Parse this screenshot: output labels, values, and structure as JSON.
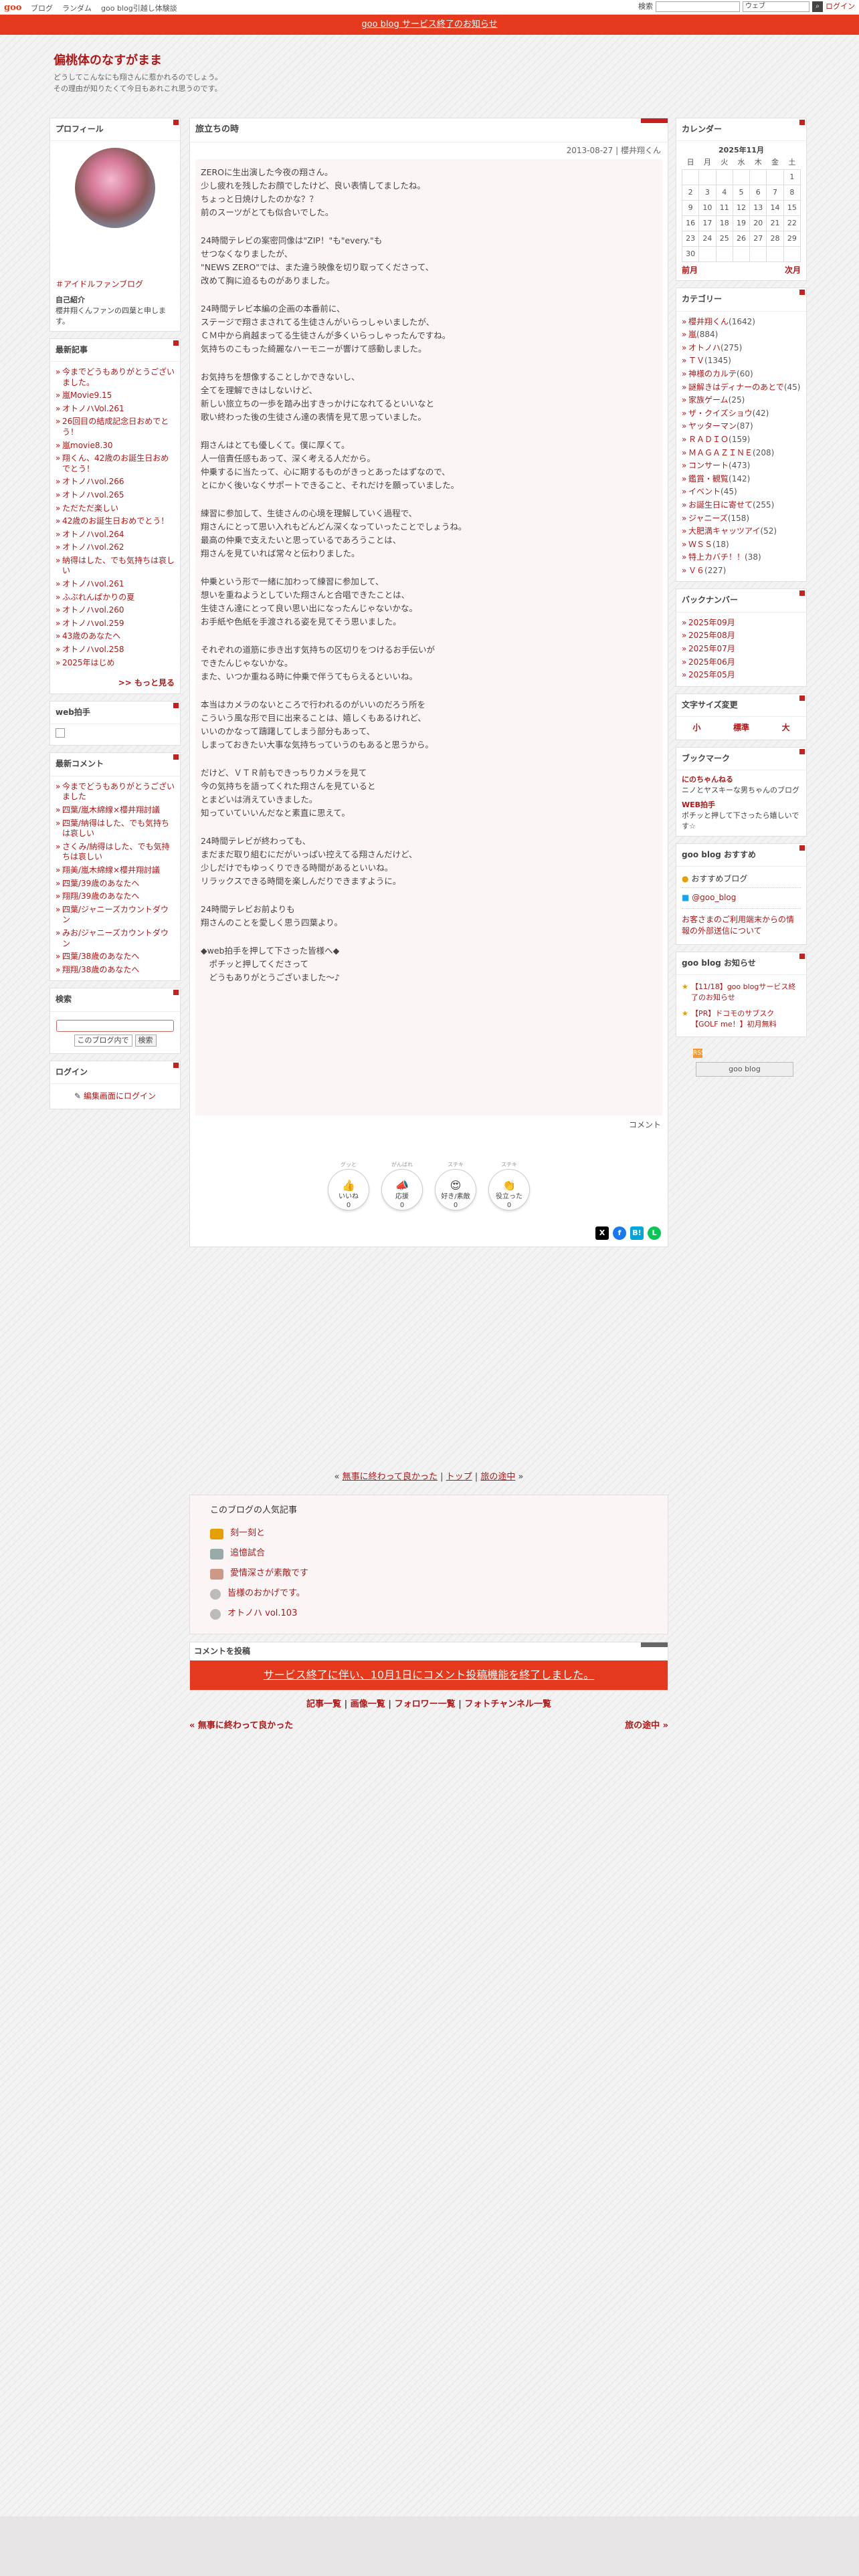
{
  "topbar": {
    "logo": "goo",
    "links": [
      "ブログ",
      "ランダム",
      "goo blog引越し体験談"
    ],
    "search_label": "検索",
    "search_select": "ウェブ",
    "login": "ログイン"
  },
  "notice": "goo blog サービス終了のお知らせ",
  "blog": {
    "title": "偏桃体のなすがまま",
    "desc1": "どうしてこんなにも翔さんに惹かれるのでしょう。",
    "desc2": "その理由が知りたくて今日もあれこれ思うのです。"
  },
  "profile": {
    "title": "プロフィール",
    "tag": "＃アイドルファンブログ",
    "intro_label": "自己紹介",
    "intro": "櫻井翔くんファンの四葉と申します。"
  },
  "recent": {
    "title": "最新記事",
    "items": [
      "今までどうもありがとうございました。",
      "嵐Movie9.15",
      "オトノハVol.261",
      "26回目の結成記念日おめでとう！",
      "嵐movie8.30",
      "翔くん、42歳のお誕生日おめでとう！",
      "オトノハvol.266",
      "オトノハvol.265",
      "ただただ楽しい",
      "42歳のお誕生日おめでとう！",
      "オトノハvol.264",
      "オトノハvol.262",
      "納得はした、でも気持ちは哀しい",
      "オトノハvol.261",
      "ふぶれんぱかりの夏",
      "オトノハvol.260",
      "オトノハvol.259",
      "43歳のあなたへ",
      "オトノハvol.258",
      "2025年はじめ"
    ],
    "more": ">> もっと見る"
  },
  "webclap": {
    "title": "web拍手"
  },
  "comments": {
    "title": "最新コメント",
    "items": [
      "今までどうもありがとうございました",
      "四葉/嵐木綿線×櫻井翔討議",
      "四葉/納得はした、でも気持ちは哀しい",
      "さくみ/納得はした、でも気持ちは哀しい",
      "翔美/嵐木綿線×櫻井翔討議",
      "四葉/39歳のあなたへ",
      "翔翔/39歳のあなたへ",
      "四葉/ジャニーズカウントダウン",
      "みお/ジャニーズカウントダウン",
      "四葉/38歳のあなたへ",
      "翔翔/38歳のあなたへ"
    ]
  },
  "search": {
    "title": "検索",
    "select": "このブログ内で",
    "btn": "検索"
  },
  "login": {
    "title": "ログイン",
    "link": "編集画面にログイン"
  },
  "article": {
    "title": "旅立ちの時",
    "meta": "2013-08-27 | 櫻井翔くん",
    "paras": [
      [
        "ZEROに生出演した今夜の翔さん。",
        "少し疲れを残したお顔でしたけど、良い表情してましたね。",
        "ちょっと日焼けしたのかな？？",
        "前のスーツがとても似合いでした。"
      ],
      [
        "24時間テレビの案密同像は\"ZIP！\"も\"every.\"も",
        "せつなくなりましたが、",
        "\"NEWS ZERO\"では、また違う映像を切り取ってくださって、",
        "改めて胸に迫るものがありました。"
      ],
      [
        "24時間テレビ本編の企画の本番前に、",
        "ステージで翔さまされてる生徒さんがいらっしゃいましたが、",
        "ＣＭ中から肩越まってる生徒さんが多くいらっしゃったんですね。",
        "気持ちのこもった綺麗なハーモニーが響けて感動しました。"
      ],
      [
        "お気持ちを想像することしかできないし、",
        "全てを理解できはしないけど、",
        "新しい旅立ちの一歩を踏み出すきっかけになれてるといいなと",
        "歌い終わった後の生徒さん達の表情を見て思っていました。"
      ],
      [
        "翔さんはとても優しくて。僕に厚くて。",
        "人一倍責任感もあって、深く考える人だから。",
        "仲乗するに当たって、心に期するものがきっとあったはずなので、",
        "とにかく後いなくサポートできること、それだけを願っていました。"
      ],
      [
        "練習に参加して、生徒さんの心境を理解していく過程で、",
        "翔さんにとって思い入れもどんどん深くなっていったことでしょうね。",
        "最高の仲乗で支えたいと思っているであろうことは、",
        "翔さんを見ていれば常々と伝わりました。"
      ],
      [
        "仲乗という形で一緒に加わって練習に参加して、",
        "想いを重ねようとしていた翔さんと合唱できたことは、",
        "生徒さん達にとって良い思い出になったんじゃないかな。",
        "お手紙や色紙を手渡される姿を見てそう思いました。"
      ],
      [
        "それぞれの道筋に歩き出す気持ちの区切りをつけるお手伝いが",
        "できたんじゃないかな。",
        "また、いつか重ねる時に仲乗で伴うてもらえるといいね。"
      ],
      [
        "本当はカメラのないところで行われるのがいいのだろう所を",
        "こういう風な形で目に出来ることは、嬉しくもあるけれど、",
        "いいのかなって躊躇してしまう部分もあって、",
        "しまっておきたい大事な気持ちっていうのもあると思うから。"
      ],
      [
        "だけど、ＶＴＲ前もできっちりカメラを見て",
        "今の気持ちを語ってくれた翔さんを見ていると",
        "とまどいは消えていきました。",
        "知っていていいんだなと素直に思えて。"
      ],
      [
        "24時間テレビが終わっても、",
        "まだまだ取り組むにだがいっぱい控えてる翔さんだけど、",
        "少しだけでもゆっくりできる時間があるといいね。",
        "リラックスできる時間を楽しんだりできますように。"
      ],
      [
        "24時間テレビお前よりも",
        "翔さんのことを愛しく思う四葉より。"
      ],
      [
        "◆web拍手を押して下さった皆様へ◆",
        "　ポチッと押してくださって",
        "　どうもありがとうございました～♪"
      ]
    ],
    "comment_link": "コメント"
  },
  "reactions": [
    {
      "top": "グッと",
      "label": "いいね",
      "count": "0"
    },
    {
      "top": "がんばれ",
      "label": "応援",
      "count": "0"
    },
    {
      "top": "ステキ",
      "label": "好き/素敵",
      "count": "0"
    },
    {
      "top": "ステキ",
      "label": "役立った",
      "count": "0"
    }
  ],
  "pager": {
    "prev": "無事に終わって良かった",
    "top": "トップ",
    "next": "旅の途中"
  },
  "popular": {
    "title": "このブログの人気記事",
    "items": [
      "刻一刻と",
      "追憶試合",
      "愛情深さが素敵です",
      "皆様のおかげです。",
      "オトノハ vol.103"
    ]
  },
  "comment_form": {
    "title": "コメントを投稿",
    "notice": "サービス終了に伴い、10月1日にコメント投稿機能を終了しました。"
  },
  "footer_links": [
    "記事一覧",
    "画像一覧",
    "フォロワー一覧",
    "フォトチャンネル一覧"
  ],
  "nav": {
    "prev": "« 無事に終わって良かった",
    "next": "旅の途中 »"
  },
  "calendar": {
    "title": "カレンダー",
    "month": "2025年11月",
    "dow": [
      "日",
      "月",
      "火",
      "水",
      "木",
      "金",
      "土"
    ],
    "prev": "前月",
    "next": "次月"
  },
  "categories": {
    "title": "カテゴリー",
    "items": [
      [
        "櫻井翔くん",
        "(1642)"
      ],
      [
        "嵐",
        "(884)"
      ],
      [
        "オトノハ",
        "(275)"
      ],
      [
        "ＴＶ",
        "(1345)"
      ],
      [
        "神様のカルテ",
        "(60)"
      ],
      [
        "謎解きはディナーのあとで",
        "(45)"
      ],
      [
        "家族ゲーム",
        "(25)"
      ],
      [
        "ザ・クイズショウ",
        "(42)"
      ],
      [
        "ヤッターマン",
        "(87)"
      ],
      [
        "ＲＡＤＩＯ",
        "(159)"
      ],
      [
        "ＭＡＧＡＺＩＮＥ",
        "(208)"
      ],
      [
        "コンサート",
        "(473)"
      ],
      [
        "鑑賞・観覧",
        "(142)"
      ],
      [
        "イベント",
        "(45)"
      ],
      [
        "お誕生日に寄せて",
        "(255)"
      ],
      [
        "ジャニーズ",
        "(158)"
      ],
      [
        "大肥満キャッツアイ",
        "(52)"
      ],
      [
        "ＷＳＳ",
        "(18)"
      ],
      [
        "特上カバチ！！",
        "(38)"
      ],
      [
        "Ｖ６",
        "(227)"
      ]
    ]
  },
  "backnumber": {
    "title": "バックナンバー",
    "items": [
      "2025年09月",
      "2025年08月",
      "2025年07月",
      "2025年06月",
      "2025年05月"
    ]
  },
  "fontsize": {
    "title": "文字サイズ変更",
    "items": [
      "小",
      "標準",
      "大"
    ]
  },
  "bookmark": {
    "title": "ブックマーク",
    "items": [
      {
        "name": "にのちゃんねる",
        "desc": "ニノとヤスキーな男ちゃんのブログ"
      },
      {
        "name": "WEB拍手",
        "desc": "ポチッと押して下さったら嬉しいです☆"
      }
    ]
  },
  "recommend": {
    "title": "goo blog おすすめ",
    "item": "おすすめブログ",
    "twitter": "@goo_blog",
    "note": "お客さまのご利用端末からの情報の外部送信について"
  },
  "announce": {
    "title": "goo blog お知らせ",
    "items": [
      "【11/18】goo blogサービス終了のお知らせ",
      "【PR】ドコモのサブスク【GOLF me！】初月無料"
    ],
    "badge": "goo blog"
  },
  "colors": {
    "accent": "#e5391d",
    "link": "#b01818"
  }
}
